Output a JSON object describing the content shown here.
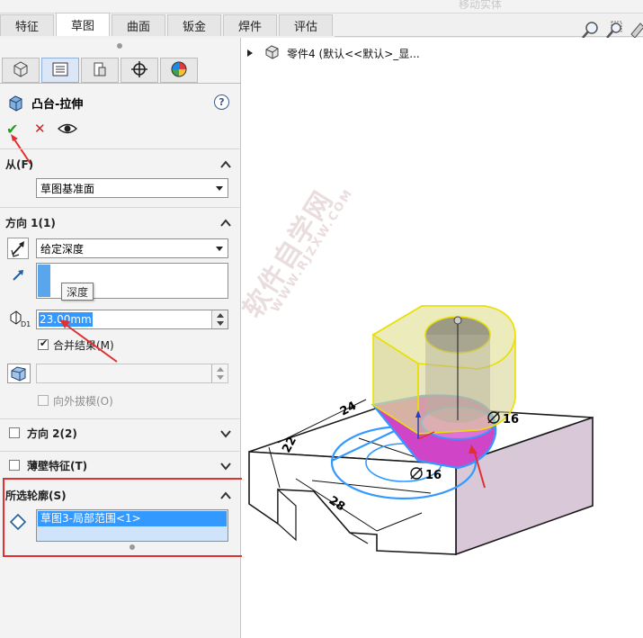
{
  "tabs": [
    {
      "label": "特征"
    },
    {
      "label": "草图"
    },
    {
      "label": "曲面"
    },
    {
      "label": "钣金"
    },
    {
      "label": "焊件"
    },
    {
      "label": "评估"
    }
  ],
  "toolbar_faded_label": "移动实体",
  "panel": {
    "title": "凸台-拉伸",
    "from": {
      "header": "从(F)",
      "value": "草图基准面"
    },
    "direction1": {
      "header": "方向 1(1)",
      "end_condition": "给定深度",
      "tooltip": "深度",
      "depth_value": "23.00mm",
      "merge_label": "合并结果(M)",
      "draft_label": "向外拔模(O)"
    },
    "direction2": {
      "header": "方向 2(2)"
    },
    "thin": {
      "header": "薄壁特征(T)"
    },
    "contours": {
      "header": "所选轮廓(S)",
      "item": "草图3-局部范围<1>"
    }
  },
  "tree": {
    "label": "零件4 (默认<<默认>_显..."
  },
  "model": {
    "dims": {
      "d24": "24",
      "d22": "22",
      "d28": "28",
      "dia_top": "16",
      "dia_mid": "16",
      "dia_sym": "⌀"
    },
    "watermark": "软件自学网",
    "watermark_url": "WWW.RJZXW.COM"
  },
  "colors": {
    "accent_blue": "#3399ff",
    "arrow_red": "#e03030",
    "magenta": "#d045c8",
    "boss_yellow": "#d9d596",
    "body_lilac": "#d8c8d8"
  }
}
